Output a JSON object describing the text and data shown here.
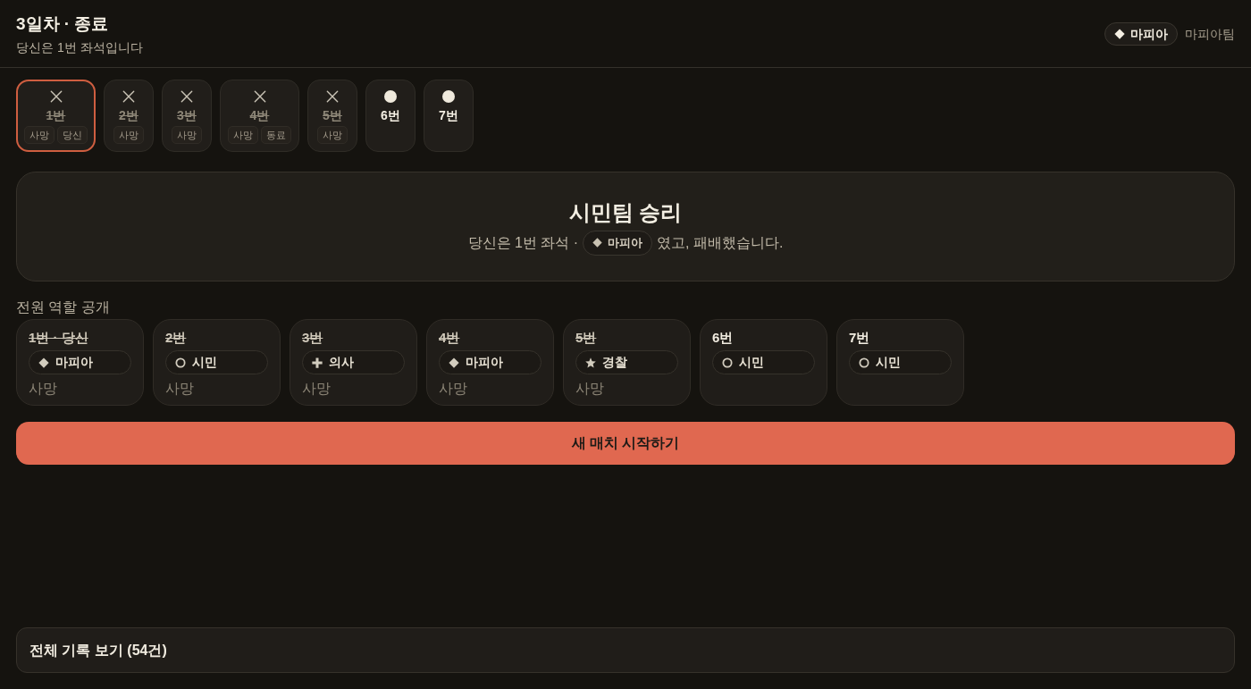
{
  "header": {
    "title": "3일차 · 종료",
    "subtitle": "당신은 1번 좌석입니다",
    "role": {
      "kind": "mafia",
      "name": "마피아"
    },
    "team": "마피아팀"
  },
  "seats": [
    {
      "label": "1번",
      "dead": true,
      "selected": true,
      "tags": [
        "사망",
        "당신"
      ]
    },
    {
      "label": "2번",
      "dead": true,
      "selected": false,
      "tags": [
        "사망"
      ]
    },
    {
      "label": "3번",
      "dead": true,
      "selected": false,
      "tags": [
        "사망"
      ]
    },
    {
      "label": "4번",
      "dead": true,
      "selected": false,
      "tags": [
        "사망",
        "동료"
      ]
    },
    {
      "label": "5번",
      "dead": true,
      "selected": false,
      "tags": [
        "사망"
      ]
    },
    {
      "label": "6번",
      "dead": false,
      "selected": false
    },
    {
      "label": "7번",
      "dead": false,
      "selected": false
    }
  ],
  "result": {
    "title": "시민팀 승리",
    "text_before": "당신은 1번 좌석 ·",
    "role": {
      "kind": "mafia",
      "name": "마피아"
    },
    "text_after": "였고, 패배했습니다."
  },
  "reveal": {
    "heading": "전원 역할 공개",
    "players": [
      {
        "label": "1번 · 당신",
        "dead": true,
        "role": {
          "kind": "mafia",
          "name": "마피아"
        },
        "status": "사망"
      },
      {
        "label": "2번",
        "dead": true,
        "role": {
          "kind": "citizen",
          "name": "시민"
        },
        "status": "사망"
      },
      {
        "label": "3번",
        "dead": true,
        "role": {
          "kind": "doctor",
          "name": "의사"
        },
        "status": "사망"
      },
      {
        "label": "4번",
        "dead": true,
        "role": {
          "kind": "mafia",
          "name": "마피아"
        },
        "status": "사망"
      },
      {
        "label": "5번",
        "dead": true,
        "role": {
          "kind": "police",
          "name": "경찰"
        },
        "status": "사망"
      },
      {
        "label": "6번",
        "dead": false,
        "role": {
          "kind": "citizen",
          "name": "시민"
        }
      },
      {
        "label": "7번",
        "dead": false,
        "role": {
          "kind": "citizen",
          "name": "시민"
        }
      }
    ]
  },
  "new_match_button": "새 매치 시작하기",
  "history_toggle": "전체 기록 보기 (54건)"
}
